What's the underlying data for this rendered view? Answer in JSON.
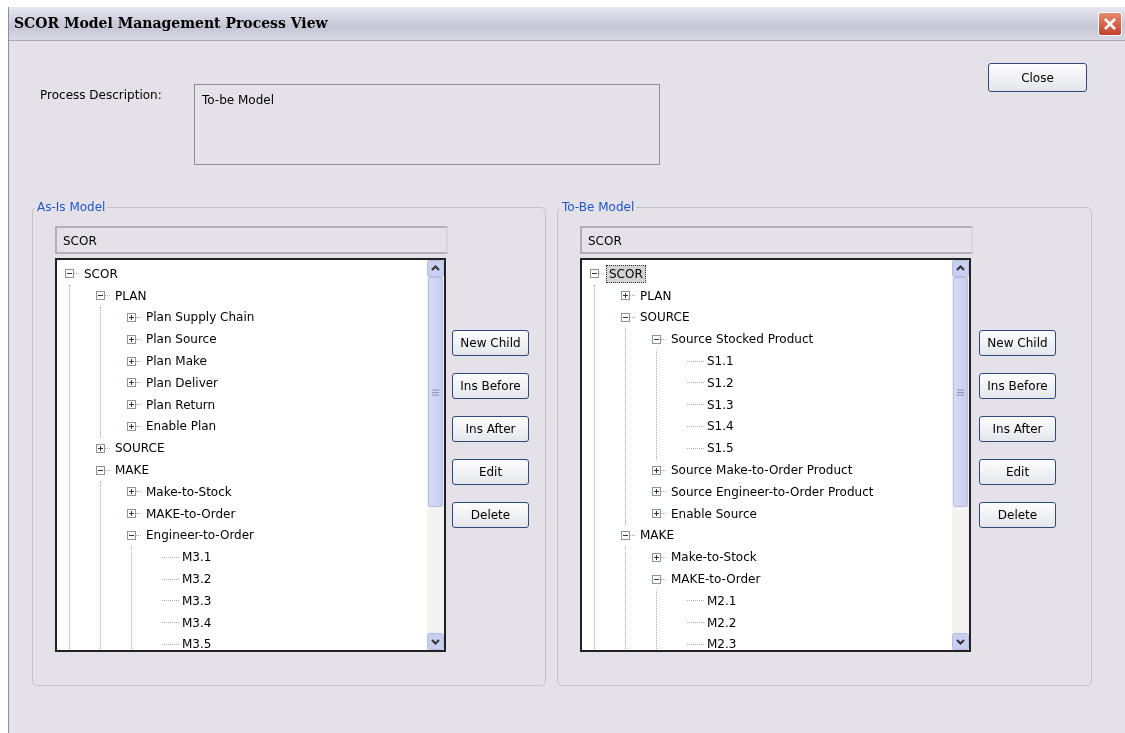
{
  "window": {
    "title": "SCOR Model Management Process View"
  },
  "close_button": "Close",
  "process_description": {
    "label": "Process Description:",
    "value": "To-be Model"
  },
  "panels": [
    {
      "title": "As-Is Model",
      "header": "SCOR",
      "tree": [
        {
          "label": "SCOR",
          "expanded": true,
          "selected": false,
          "children": [
            {
              "label": "PLAN",
              "expanded": true,
              "selected": false,
              "children": [
                {
                  "label": "Plan Supply Chain",
                  "expanded": false,
                  "selected": false
                },
                {
                  "label": "Plan Source",
                  "expanded": false,
                  "selected": false
                },
                {
                  "label": "Plan Make",
                  "expanded": false,
                  "selected": false
                },
                {
                  "label": "Plan Deliver",
                  "expanded": false,
                  "selected": false
                },
                {
                  "label": "Plan Return",
                  "expanded": false,
                  "selected": false
                },
                {
                  "label": "Enable Plan",
                  "expanded": false,
                  "selected": false
                }
              ]
            },
            {
              "label": "SOURCE",
              "expanded": false,
              "selected": false
            },
            {
              "label": "MAKE",
              "expanded": true,
              "selected": false,
              "children": [
                {
                  "label": "Make-to-Stock",
                  "expanded": false,
                  "selected": false
                },
                {
                  "label": "MAKE-to-Order",
                  "expanded": false,
                  "selected": false
                },
                {
                  "label": "Engineer-to-Order",
                  "expanded": true,
                  "selected": false,
                  "children": [
                    {
                      "label": "M3.1",
                      "selected": false
                    },
                    {
                      "label": "M3.2",
                      "selected": false
                    },
                    {
                      "label": "M3.3",
                      "selected": false
                    },
                    {
                      "label": "M3.4",
                      "selected": false
                    },
                    {
                      "label": "M3.5",
                      "selected": false
                    }
                  ]
                }
              ]
            }
          ]
        }
      ],
      "buttons": [
        "New Child",
        "Ins Before",
        "Ins After",
        "Edit",
        "Delete"
      ]
    },
    {
      "title": "To-Be Model",
      "header": "SCOR",
      "tree": [
        {
          "label": "SCOR",
          "expanded": true,
          "selected": true,
          "children": [
            {
              "label": "PLAN",
              "expanded": false,
              "selected": false
            },
            {
              "label": "SOURCE",
              "expanded": true,
              "selected": false,
              "children": [
                {
                  "label": "Source Stocked Product",
                  "expanded": true,
                  "selected": false,
                  "children": [
                    {
                      "label": "S1.1",
                      "selected": false
                    },
                    {
                      "label": "S1.2",
                      "selected": false
                    },
                    {
                      "label": "S1.3",
                      "selected": false
                    },
                    {
                      "label": "S1.4",
                      "selected": false
                    },
                    {
                      "label": "S1.5",
                      "selected": false
                    }
                  ]
                },
                {
                  "label": "Source Make-to-Order Product",
                  "expanded": false,
                  "selected": false
                },
                {
                  "label": "Source Engineer-to-Order Product",
                  "expanded": false,
                  "selected": false
                },
                {
                  "label": "Enable Source",
                  "expanded": false,
                  "selected": false
                }
              ]
            },
            {
              "label": "MAKE",
              "expanded": true,
              "selected": false,
              "children": [
                {
                  "label": "Make-to-Stock",
                  "expanded": false,
                  "selected": false
                },
                {
                  "label": "MAKE-to-Order",
                  "expanded": true,
                  "selected": false,
                  "children": [
                    {
                      "label": "M2.1",
                      "selected": false
                    },
                    {
                      "label": "M2.2",
                      "selected": false
                    },
                    {
                      "label": "M2.3",
                      "selected": false
                    }
                  ]
                }
              ]
            }
          ]
        }
      ],
      "buttons": [
        "New Child",
        "Ins Before",
        "Ins After",
        "Edit",
        "Delete"
      ]
    }
  ]
}
